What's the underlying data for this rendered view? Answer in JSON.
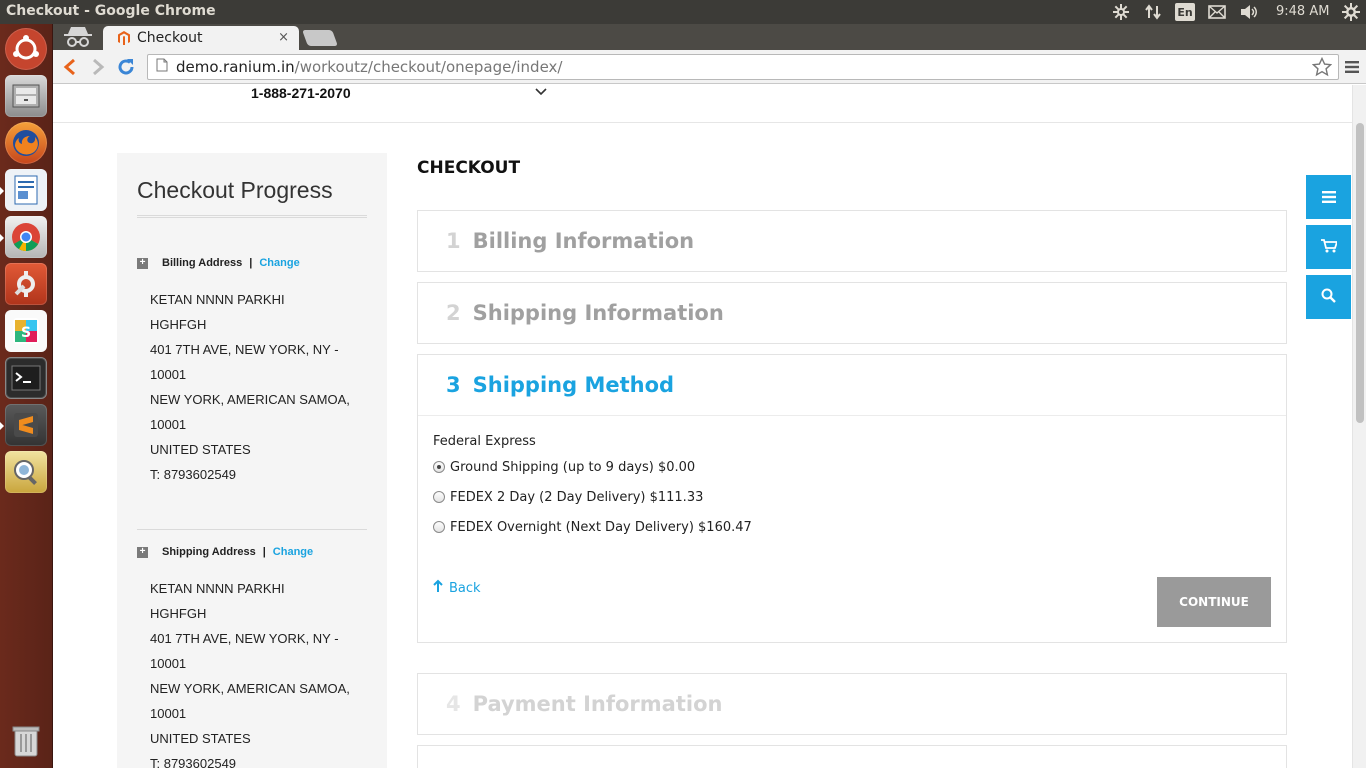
{
  "os": {
    "window_title": "Checkout - Google Chrome",
    "indicators": {
      "lang": "En",
      "clock": "9:48 AM"
    }
  },
  "browser": {
    "tab": {
      "title": "Checkout",
      "close_glyph": "×"
    },
    "url": {
      "host": "demo.ranium.in",
      "path": "/workoutz/checkout/onepage/index/"
    }
  },
  "header": {
    "phone": "1-888-271-2070"
  },
  "sidebar": {
    "title": "Checkout Progress",
    "sections": [
      {
        "label": "Billing Address",
        "separator": "|",
        "change_label": "Change",
        "lines": [
          "KETAN NNNN PARKHI",
          "HGHFGH",
          "401 7TH AVE, NEW YORK, NY -",
          "10001",
          "NEW YORK, AMERICAN SAMOA,",
          "10001",
          "UNITED STATES",
          "T: 8793602549"
        ]
      },
      {
        "label": "Shipping Address",
        "separator": "|",
        "change_label": "Change",
        "lines": [
          "KETAN NNNN PARKHI",
          "HGHFGH",
          "401 7TH AVE, NEW YORK, NY -",
          "10001",
          "NEW YORK, AMERICAN SAMOA,",
          "10001",
          "UNITED STATES",
          "T: 8793602549"
        ]
      }
    ]
  },
  "checkout": {
    "title": "CHECKOUT",
    "steps": [
      {
        "number": "1",
        "label": "Billing Information",
        "state": "inactive"
      },
      {
        "number": "2",
        "label": "Shipping Information",
        "state": "inactive"
      },
      {
        "number": "3",
        "label": "Shipping Method",
        "state": "active"
      },
      {
        "number": "4",
        "label": "Payment Information",
        "state": "disabled"
      }
    ],
    "shipping_method": {
      "carrier": "Federal Express",
      "options": [
        {
          "label": "Ground Shipping (up to 9 days) $0.00",
          "selected": true
        },
        {
          "label": "FEDEX 2 Day (2 Day Delivery) $111.33",
          "selected": false
        },
        {
          "label": "FEDEX Overnight (Next Day Delivery) $160.47",
          "selected": false
        }
      ],
      "back_label": "Back",
      "continue_label": "CONTINUE"
    }
  },
  "float_actions": [
    "menu-icon",
    "cart-icon",
    "search-icon"
  ],
  "colors": {
    "accent": "#1aa3e0",
    "button_disabled": "#9a9a9a"
  }
}
